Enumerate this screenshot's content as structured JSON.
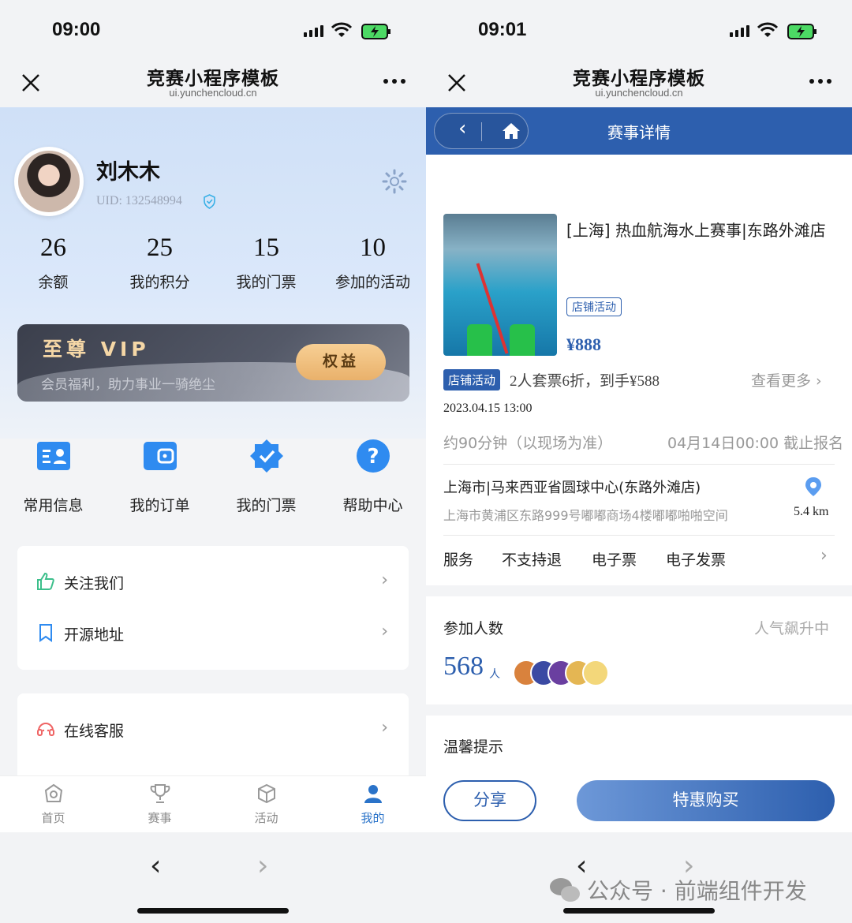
{
  "left": {
    "status": {
      "time": "09:00"
    },
    "nav": {
      "title": "竞赛小程序模板",
      "url": "ui.yunchencloud.cn"
    },
    "profile": {
      "name": "刘木木",
      "uid": "UID: 132548994"
    },
    "stats": [
      {
        "value": "26",
        "label": "余额"
      },
      {
        "value": "25",
        "label": "我的积分"
      },
      {
        "value": "15",
        "label": "我的门票"
      },
      {
        "value": "10",
        "label": "参加的活动"
      }
    ],
    "vip": {
      "title": "至尊 VIP",
      "subtitle": "会员福利，助力事业一骑绝尘",
      "button": "权益"
    },
    "quick": [
      {
        "label": "常用信息",
        "icon": "id-card-icon"
      },
      {
        "label": "我的订单",
        "icon": "wallet-icon"
      },
      {
        "label": "我的门票",
        "icon": "badge-check-icon"
      },
      {
        "label": "帮助中心",
        "icon": "help-icon"
      }
    ],
    "menu1": [
      {
        "label": "关注我们",
        "icon": "thumbs-up-icon"
      },
      {
        "label": "开源地址",
        "icon": "bookmark-icon"
      }
    ],
    "menu2": [
      {
        "label": "在线客服",
        "icon": "headset-icon"
      }
    ],
    "tabs": [
      {
        "label": "首页",
        "icon": "home-icon"
      },
      {
        "label": "赛事",
        "icon": "trophy-icon"
      },
      {
        "label": "活动",
        "icon": "cube-icon"
      },
      {
        "label": "我的",
        "icon": "user-icon"
      }
    ],
    "accent": "#2a73c9"
  },
  "right": {
    "status": {
      "time": "09:01"
    },
    "nav": {
      "title": "竞赛小程序模板",
      "url": "ui.yunchencloud.cn"
    },
    "page_title": "赛事详情",
    "event": {
      "title": "[上海] 热血航海水上赛事|东路外滩店",
      "tag": "店铺活动",
      "price": "¥888",
      "promo_tag": "店铺活动",
      "promo_text": "2人套票6折，到手¥588",
      "see_more": "查看更多 ›",
      "date": "2023.04.15 13:00",
      "duration": "约90分钟（以现场为准）",
      "deadline": "04月14日00:00 截止报名",
      "venue": "上海市|马来西亚省圆球中心(东路外滩店)",
      "address": "上海市黄浦区东路999号嘟嘟商场4楼嘟嘟啪啪空间",
      "distance": "5.4 km",
      "services": [
        "服务",
        "不支持退",
        "电子票",
        "电子发票"
      ]
    },
    "participants": {
      "label": "参加人数",
      "popularity": "人气飙升中",
      "count": "568",
      "unit": "人"
    },
    "tips": "温馨提示",
    "actions": {
      "share": "分享",
      "buy": "特惠购买"
    },
    "accent": "#2d5fae"
  },
  "watermark": "公众号 · 前端组件开发"
}
